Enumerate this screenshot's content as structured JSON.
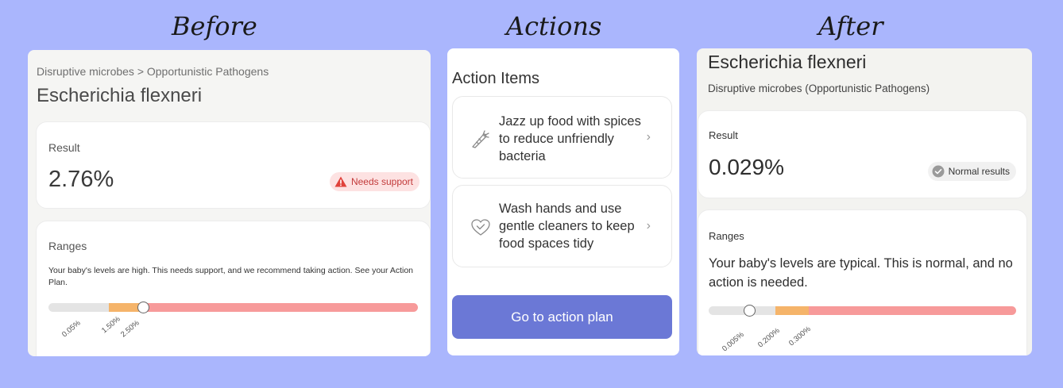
{
  "headings": {
    "before": "Before",
    "actions": "Actions",
    "after": "After"
  },
  "before": {
    "breadcrumb": "Disruptive microbes > Opportunistic Pathogens",
    "title": "Escherichia flexneri",
    "result_label": "Result",
    "result_value": "2.76%",
    "status_badge": "Needs support",
    "ranges_label": "Ranges",
    "ranges_description": "Your baby's levels are high. This needs support, and we recommend taking action. See your Action Plan.",
    "range_ticks": [
      "0.05%",
      "1.50%",
      "2.50%"
    ],
    "colors": {
      "normal": "#e4e4e4",
      "caution": "#f5b46a",
      "high": "#f79a9a",
      "badge": "#fde2e2"
    }
  },
  "actions": {
    "title": "Action Items",
    "items": [
      {
        "text": "Jazz up food with spices to reduce unfriendly bacteria",
        "icon": "carrot-icon"
      },
      {
        "text": "Wash hands and use gentle cleaners to keep food spaces tidy",
        "icon": "heart-check-icon"
      }
    ],
    "cta_label": "Go to action plan",
    "cta_color": "#6b78d6"
  },
  "after": {
    "title": "Escherichia flexneri",
    "subtitle": "Disruptive microbes (Opportunistic Pathogens)",
    "result_label": "Result",
    "result_value": "0.029%",
    "status_badge": "Normal results",
    "ranges_label": "Ranges",
    "ranges_description": "Your baby's levels are typical. This is normal, and no action is needed.",
    "range_ticks": [
      "0.005%",
      "0.200%",
      "0.300%"
    ]
  },
  "background_color": "#aab6fd"
}
